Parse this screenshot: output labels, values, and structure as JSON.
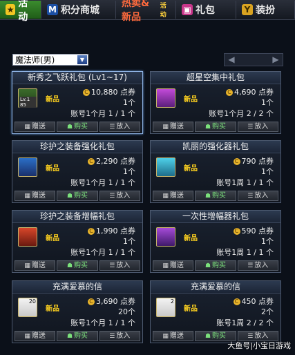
{
  "tabs": [
    {
      "label": "活动",
      "icon": "star-icon"
    },
    {
      "label": "积分商城",
      "icon": "m-logo-icon"
    },
    {
      "label": "热卖&新品",
      "sub": "活动",
      "icon": ""
    },
    {
      "label": "礼包",
      "icon": "gift-icon"
    },
    {
      "label": "装扮",
      "icon": "trophy-icon"
    }
  ],
  "filter": {
    "class_select": "魔法师(男)"
  },
  "pager": {
    "prev": "◀",
    "next": "▶"
  },
  "cards": [
    {
      "title": "新秀之飞跃礼包 (Lv1~17)",
      "badge": "新品",
      "price": "10,880 点券",
      "qty": "1个",
      "limit": "账号1个月 1 / 1 个",
      "icon_label": "Lv.1 85",
      "actions": {
        "gift": "赠送",
        "buy": "购买",
        "cart": "放入"
      }
    },
    {
      "title": "超星空集中礼包",
      "badge": "新品",
      "price": "4,690 点券",
      "qty": "1个",
      "limit": "账号1个月 2 / 2 个",
      "icon_label": "",
      "actions": {
        "gift": "赠送",
        "buy": "购买",
        "cart": "放入"
      }
    },
    {
      "title": "珍护之装备强化礼包",
      "badge": "新品",
      "price": "2,290 点券",
      "qty": "1个",
      "limit": "账号1个月 1 / 1 个",
      "icon_label": "",
      "actions": {
        "gift": "赠送",
        "buy": "购买",
        "cart": "放入"
      }
    },
    {
      "title": "凯丽的强化器礼包",
      "badge": "新品",
      "price": "790 点券",
      "qty": "1个",
      "limit": "账号1周 1 / 1 个",
      "icon_label": "",
      "actions": {
        "gift": "赠送",
        "buy": "购买",
        "cart": "放入"
      }
    },
    {
      "title": "珍护之装备增幅礼包",
      "badge": "新品",
      "price": "1,990 点券",
      "qty": "1个",
      "limit": "账号1个月 1 / 1 个",
      "icon_label": "",
      "actions": {
        "gift": "赠送",
        "buy": "购买",
        "cart": "放入"
      }
    },
    {
      "title": "一次性增幅器礼包",
      "badge": "新品",
      "price": "590 点券",
      "qty": "1个",
      "limit": "账号1周 1 / 1 个",
      "icon_label": "",
      "actions": {
        "gift": "赠送",
        "buy": "购买",
        "cart": "放入"
      }
    },
    {
      "title": "充满爱慕的信",
      "badge": "新品",
      "price": "3,690 点券",
      "qty": "20个",
      "limit": "账号1个月 1 / 1 个",
      "icon_label": "20",
      "actions": {
        "gift": "赠送",
        "buy": "购买",
        "cart": "放入"
      }
    },
    {
      "title": "充满爱慕的信",
      "badge": "新品",
      "price": "450 点券",
      "qty": "2个",
      "limit": "账号1周 2 / 2 个",
      "icon_label": "2",
      "actions": {
        "gift": "赠送",
        "buy": "购买",
        "cart": "放入"
      }
    }
  ],
  "watermark": "大鱼号|小宝日游戏"
}
